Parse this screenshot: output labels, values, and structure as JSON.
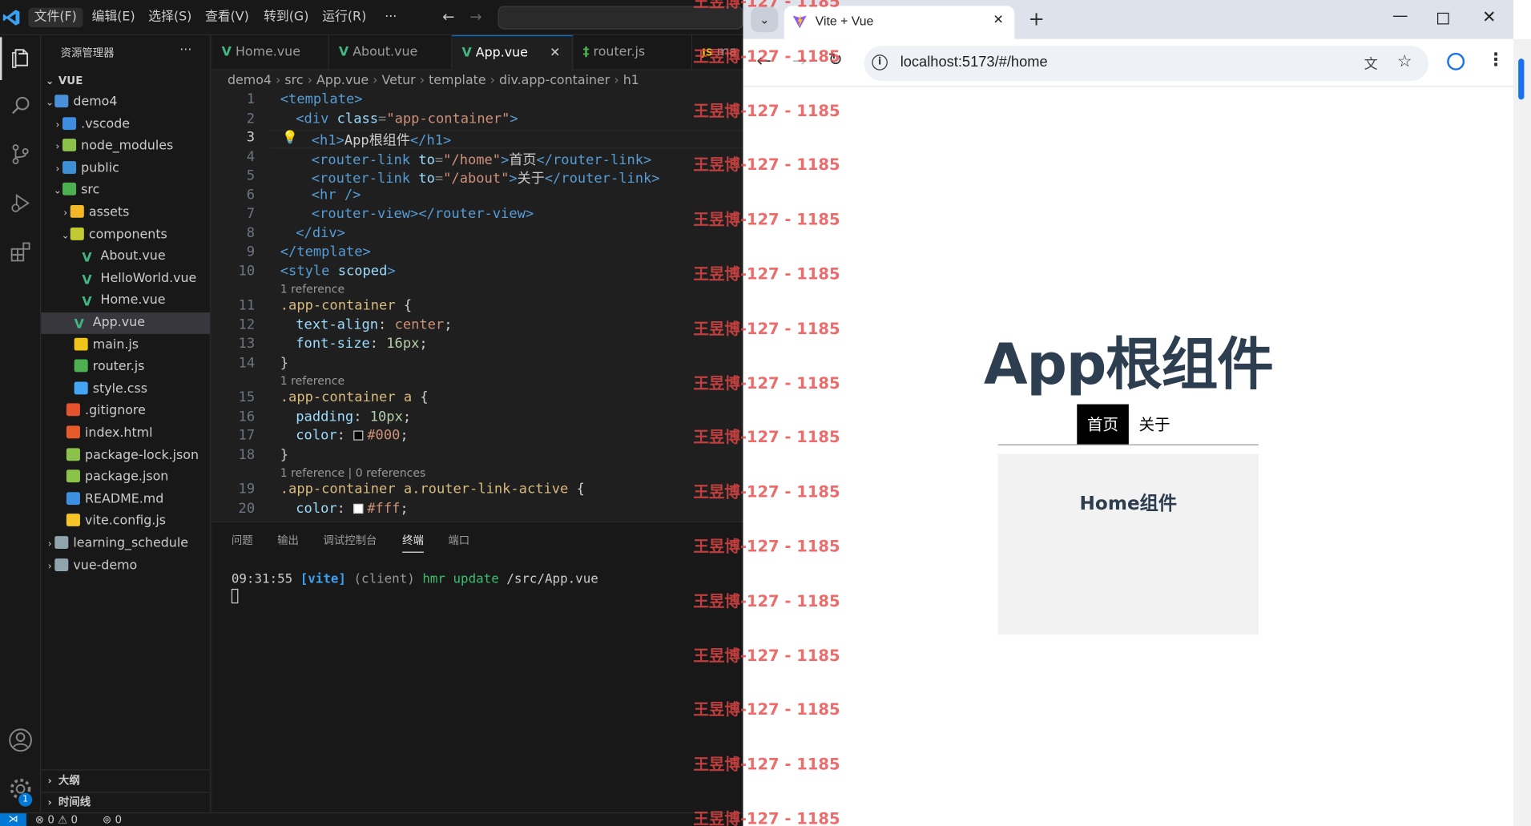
{
  "vscode": {
    "menu": [
      "文件(F)",
      "编辑(E)",
      "选择(S)",
      "查看(V)",
      "转到(G)",
      "运行(R)",
      "···"
    ],
    "explorer_title": "资源管理器",
    "explorer_more": "···",
    "workspace": "VUE",
    "tree": [
      {
        "label": "demo4",
        "depth": 1,
        "chev": "⌄",
        "icon": "folder-open-icon",
        "color": "#4a8fd9"
      },
      {
        "label": ".vscode",
        "depth": 2,
        "chev": "›",
        "icon": "vscode-folder-icon",
        "color": "#3e8ee0"
      },
      {
        "label": "node_modules",
        "depth": 2,
        "chev": "›",
        "icon": "node-folder-icon",
        "color": "#8bc34a"
      },
      {
        "label": "public",
        "depth": 2,
        "chev": "›",
        "icon": "public-folder-icon",
        "color": "#3d8fd6"
      },
      {
        "label": "src",
        "depth": 2,
        "chev": "⌄",
        "icon": "src-folder-icon",
        "color": "#4caf50"
      },
      {
        "label": "assets",
        "depth": 3,
        "chev": "›",
        "icon": "assets-folder-icon",
        "color": "#f5b72a"
      },
      {
        "label": "components",
        "depth": 3,
        "chev": "⌄",
        "icon": "components-folder-icon",
        "color": "#c0ca33"
      },
      {
        "label": "About.vue",
        "depth": 4,
        "chev": "",
        "icon": "vue-icon",
        "color": "#41b883"
      },
      {
        "label": "HelloWorld.vue",
        "depth": 4,
        "chev": "",
        "icon": "vue-icon",
        "color": "#41b883"
      },
      {
        "label": "Home.vue",
        "depth": 4,
        "chev": "",
        "icon": "vue-icon",
        "color": "#41b883"
      },
      {
        "label": "App.vue",
        "depth": 3,
        "chev": "",
        "icon": "vue-icon",
        "color": "#41b883",
        "selected": true
      },
      {
        "label": "main.js",
        "depth": 3,
        "chev": "",
        "icon": "js-icon",
        "color": "#f0c419"
      },
      {
        "label": "router.js",
        "depth": 3,
        "chev": "",
        "icon": "router-icon",
        "color": "#4caf50"
      },
      {
        "label": "style.css",
        "depth": 3,
        "chev": "",
        "icon": "css-icon",
        "color": "#42a5f5"
      },
      {
        "label": ".gitignore",
        "depth": 2,
        "chev": "",
        "icon": "git-icon",
        "color": "#e4532e"
      },
      {
        "label": "index.html",
        "depth": 2,
        "chev": "",
        "icon": "html-icon",
        "color": "#e65a2b"
      },
      {
        "label": "package-lock.json",
        "depth": 2,
        "chev": "",
        "icon": "npm-icon",
        "color": "#8bc34a"
      },
      {
        "label": "package.json",
        "depth": 2,
        "chev": "",
        "icon": "npm-icon",
        "color": "#8bc34a"
      },
      {
        "label": "README.md",
        "depth": 2,
        "chev": "",
        "icon": "info-icon",
        "color": "#3d8fe0"
      },
      {
        "label": "vite.config.js",
        "depth": 2,
        "chev": "",
        "icon": "vite-icon",
        "color": "#f7c427"
      },
      {
        "label": "learning_schedule",
        "depth": 1,
        "chev": "›",
        "icon": "folder-icon",
        "color": "#90a4ae"
      },
      {
        "label": "vue-demo",
        "depth": 1,
        "chev": "›",
        "icon": "folder-icon",
        "color": "#90a4ae"
      }
    ],
    "outline": "大纲",
    "timeline": "时间线",
    "tabs": [
      {
        "label": "Home.vue",
        "icon": "vue-icon"
      },
      {
        "label": "About.vue",
        "icon": "vue-icon"
      },
      {
        "label": "App.vue",
        "icon": "vue-icon",
        "active": true,
        "close": "✕"
      },
      {
        "label": "router.js",
        "icon": "router-icon"
      },
      {
        "label": "ma",
        "icon": "js-icon"
      }
    ],
    "breadcrumb": [
      "demo4",
      "src",
      "App.vue",
      "Vetur",
      "template",
      "div.app-container",
      "h1"
    ],
    "line_numbers": [
      "1",
      "2",
      "3",
      "4",
      "5",
      "6",
      "7",
      "8",
      "9",
      "10",
      "11",
      "12",
      "13",
      "14",
      "15",
      "16",
      "17",
      "18",
      "19",
      "20"
    ],
    "lens_reference": "1 reference",
    "lens_reference_zero": "1 reference | 0 references",
    "code": {
      "l1": [
        "<template>"
      ],
      "l2": [
        "<div ",
        "class",
        "=",
        "\"app-container\"",
        ">"
      ],
      "l3": [
        "<h1>",
        "App根组件",
        "</h1>"
      ],
      "l4": [
        "<router-link ",
        "to",
        "=",
        "\"/home\"",
        ">",
        "首页",
        "</router-link>"
      ],
      "l5": [
        "<router-link ",
        "to",
        "=",
        "\"/about\"",
        ">",
        "关于",
        "</router-link>"
      ],
      "l6": [
        "<hr />"
      ],
      "l7": [
        "<router-view></router-view>"
      ],
      "l8": [
        "</div>"
      ],
      "l9": [
        "</template>"
      ],
      "l10": [
        "<style ",
        "scoped",
        ">"
      ],
      "l11": [
        ".app-container",
        " {"
      ],
      "l12": [
        "text-align",
        ": ",
        "center",
        ";"
      ],
      "l13": [
        "font-size",
        ": ",
        "16px",
        ";"
      ],
      "l14": [
        "}"
      ],
      "l15": [
        ".app-container a",
        " {"
      ],
      "l16": [
        "padding",
        ": ",
        "10px",
        ";"
      ],
      "l17": [
        "color",
        ": ",
        "#000",
        ";"
      ],
      "l18": [
        "}"
      ],
      "l19": [
        ".app-container a.router-link-active",
        " {"
      ],
      "l20": [
        "color",
        ": ",
        "#fff",
        ";"
      ]
    },
    "panel_tabs": [
      "问题",
      "输出",
      "调试控制台",
      "终端",
      "端口"
    ],
    "terminal": {
      "time": "09:31:55",
      "tag": "[vite]",
      "client": "(client)",
      "hmr": "hmr",
      "update": "update",
      "path": "/src/App.vue"
    },
    "status": {
      "errors": "0",
      "warnings": "0",
      "ports": "0"
    },
    "accounts_badge": "1"
  },
  "watermark": {
    "name": "王昱博",
    "code": "-127 - 1185"
  },
  "browser": {
    "tab_title": "Vite + Vue",
    "tab_close": "✕",
    "new_tab": "+",
    "url": "localhost:5173/#/home",
    "page": {
      "h1": "App根组件",
      "links": [
        {
          "label": "首页",
          "active": true
        },
        {
          "label": "关于"
        }
      ],
      "view_title": "Home组件"
    }
  },
  "colors": {
    "accent": "#0078d4",
    "vue_green": "#41b883",
    "page_text": "#2c3e50"
  }
}
